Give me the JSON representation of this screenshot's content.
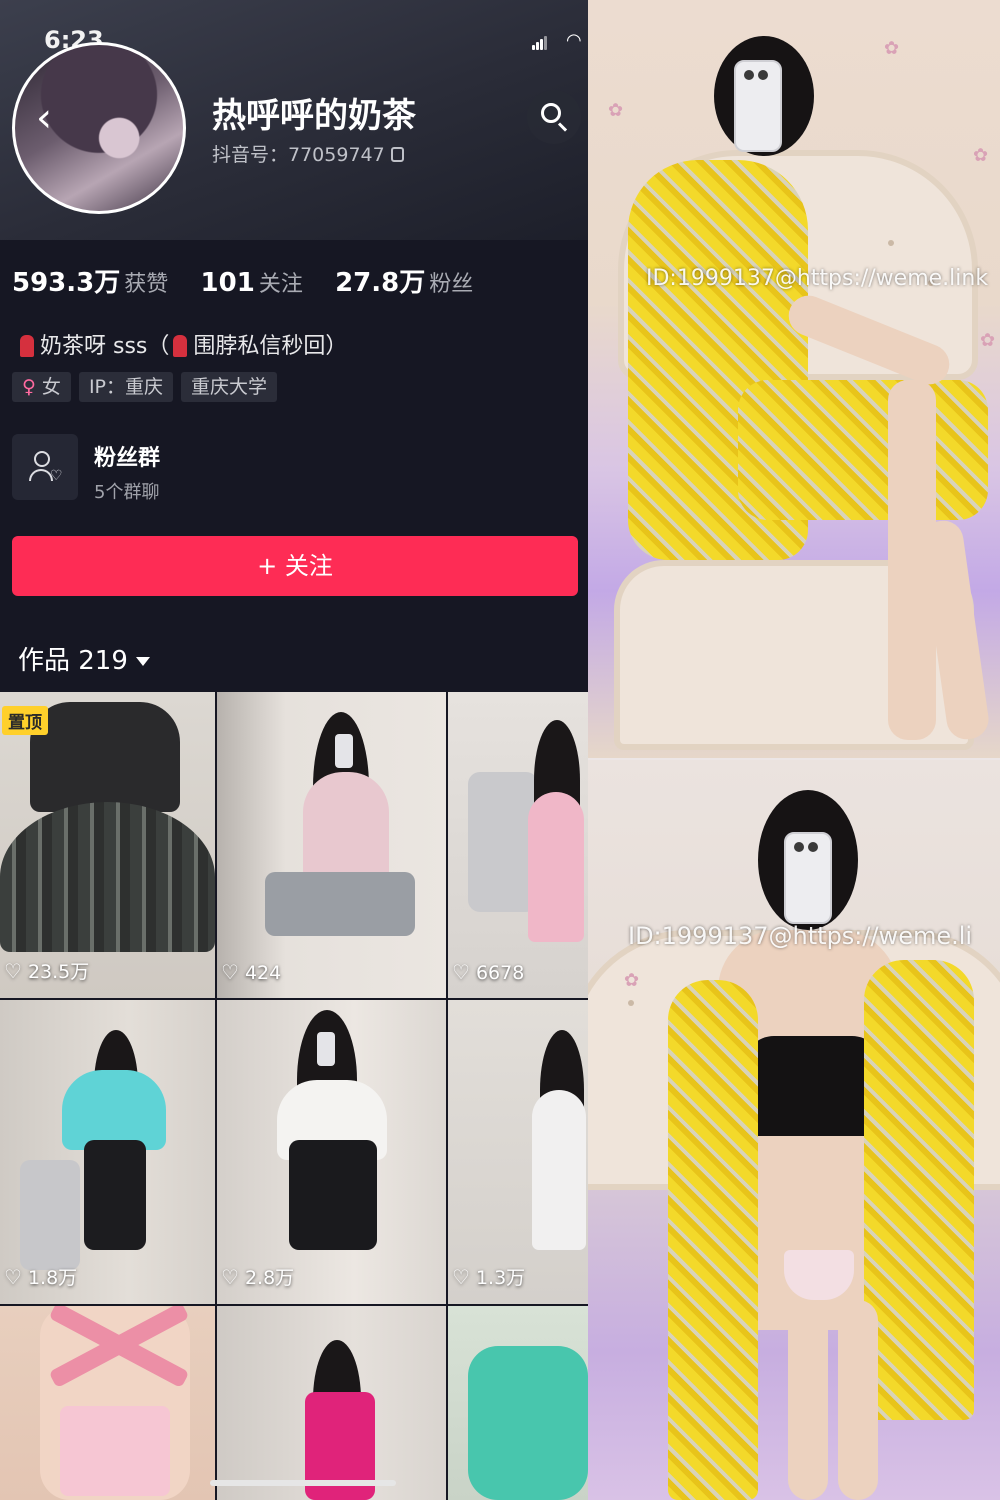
{
  "status_bar": {
    "time": "6:23"
  },
  "profile": {
    "back_glyph": "‹",
    "username": "热呼呼的奶茶",
    "douyin_id": "抖音号：77059747",
    "stats": [
      {
        "value": "593.3万",
        "label": "获赞"
      },
      {
        "value": "101",
        "label": "关注"
      },
      {
        "value": "27.8万",
        "label": "粉丝"
      }
    ],
    "bio_part1": "奶茶呀 sss（",
    "bio_part2": "围脖私信秒回）",
    "tags": {
      "gender_symbol": "♀",
      "gender": "女",
      "ip": "IP：重庆",
      "school": "重庆大学"
    },
    "fan_group": {
      "title": "粉丝群",
      "subtitle": "5个群聊"
    },
    "follow_label": "+ 关注",
    "works_label": "作品 219",
    "pinned_badge": "置顶",
    "posts": [
      {
        "likes": "23.5万"
      },
      {
        "likes": "424"
      },
      {
        "likes": "6678"
      },
      {
        "likes": "1.8万"
      },
      {
        "likes": "2.8万"
      },
      {
        "likes": "1.3万"
      }
    ]
  },
  "photos": {
    "watermark_top": "ID:1999137@https://weme.link",
    "watermark_bottom": "ID:1999137@https://weme.li"
  },
  "colors": {
    "accent": "#fe2c55",
    "background": "#161723",
    "pinned": "#ffd02b",
    "dress_yellow": "#f3d92a",
    "bedding_lilac": "#c3a9e6"
  },
  "icons": [
    "back-icon",
    "search-icon",
    "copy-icon",
    "scarf-icon",
    "female-icon",
    "fan-group-icon",
    "heart-icon",
    "caret-down-icon",
    "signal-icon",
    "wifi-icon"
  ]
}
